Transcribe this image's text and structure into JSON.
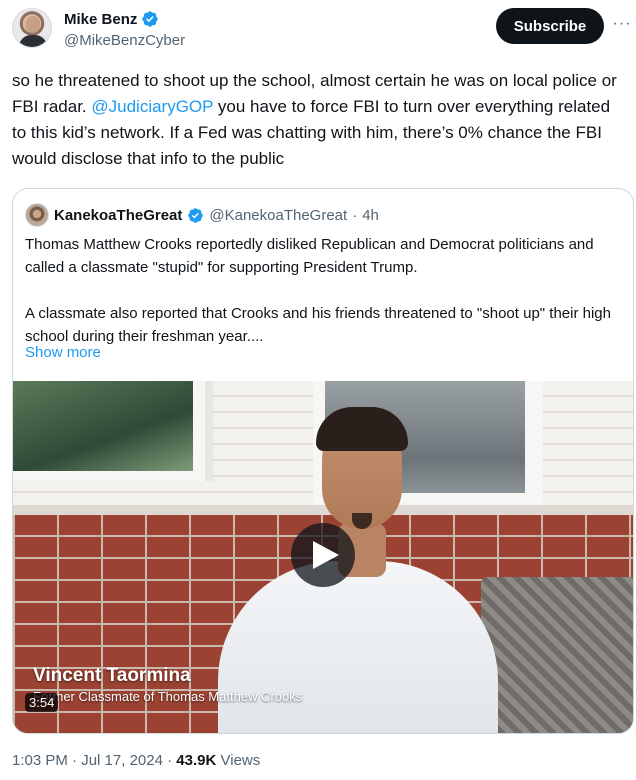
{
  "author": {
    "name": "Mike Benz",
    "handle": "@MikeBenzCyber",
    "verified_icon": "verified-badge-icon"
  },
  "actions": {
    "subscribe_label": "Subscribe",
    "more_label": "···"
  },
  "tweet": {
    "text_before": "so he threatened to shoot up the school, almost certain he was on local police or FBI radar. ",
    "mention": "@JudiciaryGOP",
    "text_after": " you have to force FBI to turn over everything related to this kid’s network. If a Fed was chatting with him, there’s 0% chance the FBI would disclose that info to the public"
  },
  "quote": {
    "name": "KanekoaTheGreat",
    "handle": "@KanekoaTheGreat",
    "sep": "·",
    "time": "4h",
    "paragraph1": "Thomas Matthew Crooks reportedly disliked Republican and Democrat politicians and called a classmate \"stupid\" for supporting President Trump.",
    "paragraph2": "A classmate also reported that Crooks and his friends threatened to \"shoot up\" their high school during their freshman year....",
    "show_more": "Show more",
    "video": {
      "caption_name": "Vincent Taormina",
      "caption_sub": "Former Classmate of Thomas Matthew Crooks",
      "duration": "3:54"
    }
  },
  "footer": {
    "time": "1:03 PM",
    "sep1": "·",
    "date": "Jul 17, 2024",
    "sep2": "·",
    "views_count": "43.9K",
    "views_label": "Views"
  },
  "colors": {
    "accent": "#1d9bf0",
    "text": "#0f1419",
    "secondary": "#536471"
  }
}
